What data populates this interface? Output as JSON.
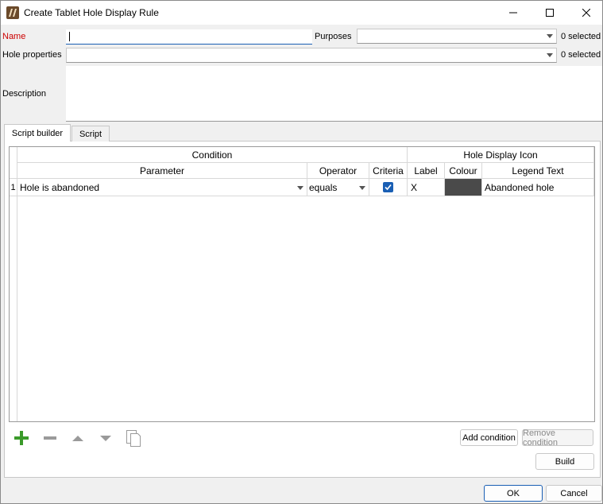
{
  "window": {
    "title": "Create Tablet Hole Display Rule"
  },
  "form": {
    "name_label": "Name",
    "name_value": "",
    "purposes_label": "Purposes",
    "purposes_count": "0 selected",
    "hole_properties_label": "Hole properties",
    "hole_properties_count": "0 selected",
    "description_label": "Description",
    "description_value": ""
  },
  "tabs": [
    {
      "label": "Script builder",
      "active": true
    },
    {
      "label": "Script",
      "active": false
    }
  ],
  "table": {
    "group_headers": [
      "Condition",
      "Hole Display Icon"
    ],
    "columns": [
      "Parameter",
      "Operator",
      "Criteria",
      "Label",
      "Colour",
      "Legend Text"
    ],
    "rows": [
      {
        "num": "1",
        "parameter": "Hole is abandoned",
        "operator": "equals",
        "criteria_checked": true,
        "label": "X",
        "colour": "#4a4a4a",
        "legend_text": "Abandoned hole"
      }
    ]
  },
  "toolbar": {
    "add_icon": "plus-icon",
    "remove_icon": "minus-icon",
    "up_icon": "arrow-up-icon",
    "down_icon": "arrow-down-icon",
    "copy_icon": "copy-icon",
    "add_condition_label": "Add condition",
    "remove_condition_label": "Remove condition",
    "build_label": "Build"
  },
  "footer": {
    "ok_label": "OK",
    "cancel_label": "Cancel"
  },
  "colors": {
    "accent": "#1a5fb4",
    "add_green": "#3a9a2a",
    "required_red": "#cc0000"
  }
}
